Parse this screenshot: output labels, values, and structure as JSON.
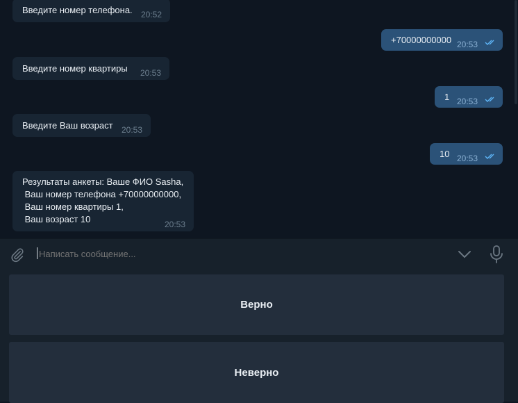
{
  "messages": [
    {
      "side": "in",
      "text": "Введите номер телефона.",
      "time": "20:52"
    },
    {
      "side": "out",
      "text": "+70000000000",
      "time": "20:53",
      "read": true
    },
    {
      "side": "in",
      "text": "Введите номер квартиры",
      "time": "20:53"
    },
    {
      "side": "out",
      "text": "1",
      "time": "20:53",
      "read": true
    },
    {
      "side": "in",
      "text": "Введите Ваш возраст",
      "time": "20:53"
    },
    {
      "side": "out",
      "text": "10",
      "time": "20:53",
      "read": true
    },
    {
      "side": "in",
      "text": "Результаты анкеты: Ваше ФИО Sasha,\n Ваш номер телефона +70000000000,\n Ваш номер квартиры 1,\n Ваш возраст 10",
      "time": "20:53"
    }
  ],
  "composer": {
    "placeholder": "Написать сообщение...",
    "icons": [
      "paperclip-icon",
      "chevron-down-icon",
      "microphone-icon"
    ]
  },
  "keyboard": {
    "buttons": [
      {
        "label": "Верно"
      },
      {
        "label": "Неверно"
      }
    ]
  },
  "colors": {
    "background": "#0e1621",
    "incoming_bubble": "#182533",
    "outgoing_bubble": "#2b5278",
    "panel": "#17212b",
    "button": "#232e3c",
    "read_ticks": "#5eb5f7"
  }
}
